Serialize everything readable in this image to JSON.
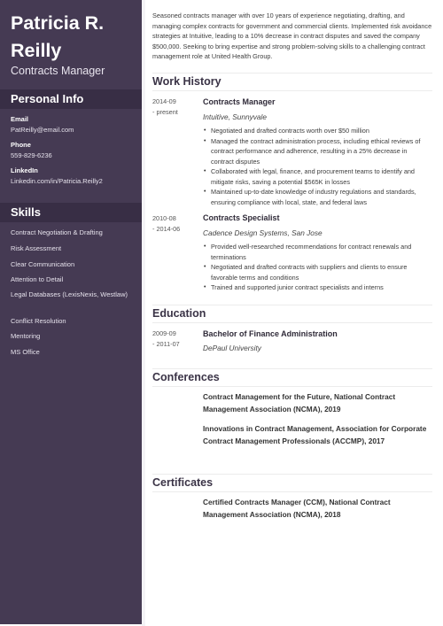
{
  "header": {
    "name_line1": "Patricia R.",
    "name_line2": "Reilly",
    "job_title": "Contracts Manager"
  },
  "personal_info": {
    "heading": "Personal Info",
    "fields": [
      {
        "label": "Email",
        "value": "PatReilly@email.com"
      },
      {
        "label": "Phone",
        "value": "559-829-6236"
      },
      {
        "label": "LinkedIn",
        "value": "Linkedin.com/in/Patricia.Reilly2"
      }
    ]
  },
  "skills": {
    "heading": "Skills",
    "items": [
      "Contract Negotiation & Drafting",
      "Risk Assessment",
      "Clear Communication",
      "Attention to Detail",
      "Legal Databases (LexisNexis, Westlaw)",
      "Conflict Resolution",
      "Mentoring",
      "MS Office"
    ]
  },
  "summary": "Seasoned contracts manager with over 10 years of experience negotiating, drafting, and managing complex contracts for government and commercial clients. Implemented risk avoidance strategies at Intuitive, leading to a 10% decrease in contract disputes and saved the company $500,000. Seeking to bring expertise and strong problem-solving skills to a challenging contract management role at United Health Group.",
  "work_history": {
    "heading": "Work History",
    "jobs": [
      {
        "date_start": "2014-09",
        "date_end": "- present",
        "title": "Contracts Manager",
        "company": "Intuitive, Sunnyvale",
        "bullets": [
          "Negotiated and drafted contracts worth over $50 million",
          "Managed the contract administration process, including ethical reviews of contract performance and adherence, resulting in a 25% decrease in contract disputes",
          "Collaborated with legal, finance, and procurement teams to identify and mitigate risks, saving a potential $565K in losses",
          "Maintained up-to-date knowledge of industry regulations and standards, ensuring compliance with local, state, and federal laws"
        ]
      },
      {
        "date_start": "2010-08",
        "date_end": "- 2014-06",
        "title": "Contracts Specialist",
        "company": "Cadence Design Systems, San Jose",
        "bullets": [
          "Provided well-researched recommendations for contract renewals and terminations",
          "Negotiated and drafted contracts with suppliers and clients to ensure favorable terms and conditions",
          "Trained and supported junior contract specialists and interns"
        ]
      }
    ]
  },
  "education": {
    "heading": "Education",
    "items": [
      {
        "date_start": "2009-09",
        "date_end": "- 2011-07",
        "degree": "Bachelor of Finance Administration",
        "school": "DePaul University"
      }
    ]
  },
  "conferences": {
    "heading": "Conferences",
    "items": [
      "Contract Management for the Future, National Contract Management Association (NCMA), 2019",
      "Innovations in Contract Management, Association for Corporate Contract Management Professionals (ACCMP), 2017"
    ]
  },
  "certificates": {
    "heading": "Certificates",
    "items": [
      "Certified Contracts Manager (CCM), National Contract Management Association (NCMA), 2018"
    ]
  },
  "colors": {
    "sidebar": "#453a53",
    "sidebar_header": "#382e45",
    "section_title": "#3a3346"
  }
}
